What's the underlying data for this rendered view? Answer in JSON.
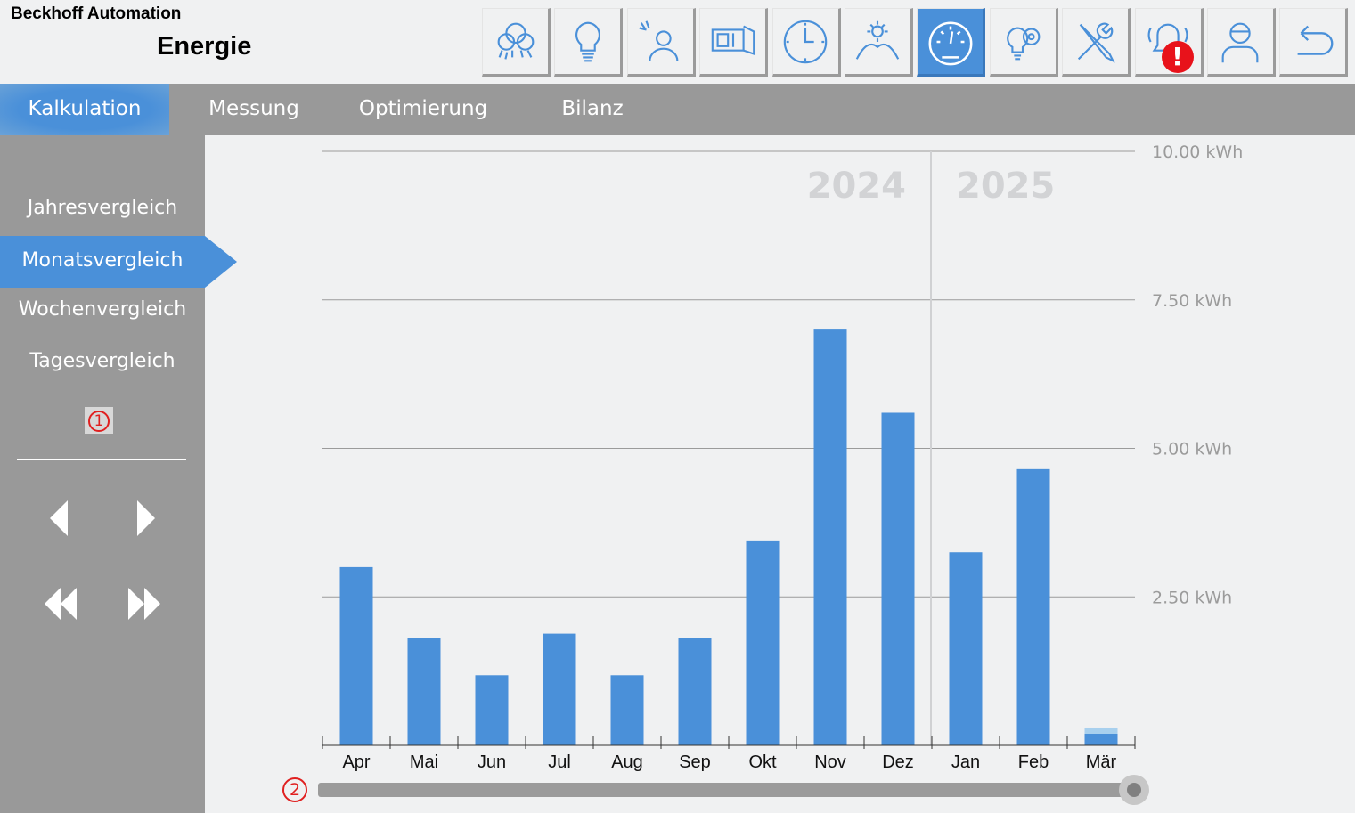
{
  "header": {
    "brand": "Beckhoff Automation",
    "title": "Energie"
  },
  "nav_buttons": [
    {
      "icon": "lights-group-icon",
      "active": false
    },
    {
      "icon": "lightbulb-icon",
      "active": false
    },
    {
      "icon": "presence-sensor-icon",
      "active": false
    },
    {
      "icon": "window-blind-icon",
      "active": false
    },
    {
      "icon": "clock-icon",
      "active": false
    },
    {
      "icon": "weather-sun-icon",
      "active": false
    },
    {
      "icon": "energy-meter-icon",
      "active": true
    },
    {
      "icon": "idea-settings-icon",
      "active": false
    },
    {
      "icon": "tools-icon",
      "active": false
    },
    {
      "icon": "alarm-bell-icon",
      "active": false,
      "badge": "!"
    },
    {
      "icon": "user-icon",
      "active": false
    },
    {
      "icon": "back-icon",
      "active": false
    }
  ],
  "tabs": [
    "Kalkulation",
    "Messung",
    "Optimierung",
    "Bilanz"
  ],
  "active_tab": "Kalkulation",
  "sidebar": {
    "items": [
      "Jahresvergleich",
      "Monatsvergleich",
      "Wochenvergleich",
      "Tagesvergleich"
    ],
    "active": "Monatsvergleich",
    "marker_1": "1"
  },
  "slider": {
    "marker_2": "2",
    "value": 1.0
  },
  "colors": {
    "accent": "#4a90d9",
    "panel": "#999999",
    "background": "#f0f1f2",
    "alarm": "#e8121b",
    "highlight_segment": "#a8d0ee"
  },
  "chart_data": {
    "type": "bar",
    "categories": [
      "Apr",
      "Mai",
      "Jun",
      "Jul",
      "Aug",
      "Sep",
      "Okt",
      "Nov",
      "Dez",
      "Jan",
      "Feb",
      "Mär"
    ],
    "values": [
      3.0,
      1.8,
      1.18,
      1.88,
      1.18,
      1.8,
      3.45,
      7.0,
      5.6,
      3.25,
      4.65,
      0.3
    ],
    "year_labels": [
      "2024",
      "2025"
    ],
    "year_split_after": "Dez",
    "ytick_labels": [
      "10.00 kWh",
      "7.50 kWh",
      "5.00 kWh",
      "2.50 kWh"
    ],
    "ytick_values": [
      10,
      7.5,
      5,
      2.5
    ],
    "ylim": [
      0,
      10
    ],
    "grid": true,
    "title": "",
    "xlabel": "",
    "ylabel": ""
  }
}
